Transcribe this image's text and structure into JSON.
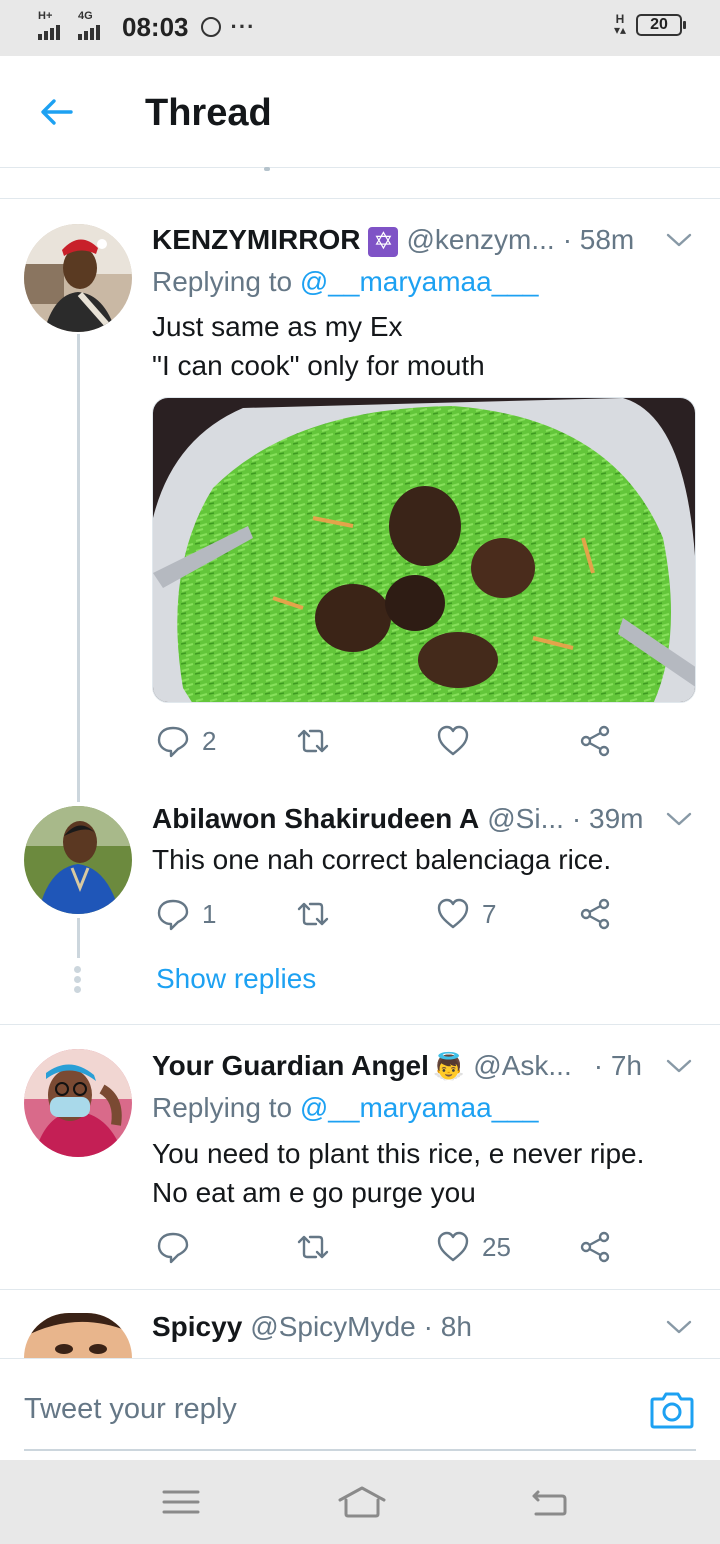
{
  "status_bar": {
    "signal1_label": "H+",
    "signal2_label": "4G",
    "time": "08:03",
    "more": "···",
    "network_right": "H",
    "battery": "20"
  },
  "header": {
    "title": "Thread"
  },
  "tweets": [
    {
      "name": "KENZYMIRROR",
      "badge": "✡",
      "handle": "@kenzym...",
      "time": "· 58m",
      "replying_prefix": "Replying to ",
      "replying_to": "@__maryamaa___",
      "lines": [
        "Just same as my Ex",
        "\"I can cook\" only for mouth"
      ],
      "reply_count": "2",
      "retweet_count": "",
      "like_count": ""
    },
    {
      "name": "Abilawon Shakirudeen A",
      "handle": "@Si...",
      "time": "· 39m",
      "lines": [
        "This one nah correct balenciaga rice."
      ],
      "reply_count": "1",
      "retweet_count": "",
      "like_count": "7"
    },
    {
      "name": "Your Guardian Angel",
      "badge": "👼",
      "handle": "@Ask...",
      "time": "· 7h",
      "replying_prefix": "Replying to ",
      "replying_to": "@__maryamaa___",
      "lines": [
        "You need to plant this rice, e never ripe.",
        "No eat am e go purge you"
      ],
      "reply_count": "",
      "retweet_count": "",
      "like_count": "25"
    },
    {
      "name": "Spicyy",
      "handle": "@SpicyMyde",
      "time": "· 8h"
    }
  ],
  "show_replies": "Show replies",
  "reply_bar": {
    "placeholder": "Tweet your reply"
  },
  "colors": {
    "accent": "#1da1f2",
    "secondary_text": "#657786",
    "divider": "#e1e8ed"
  }
}
